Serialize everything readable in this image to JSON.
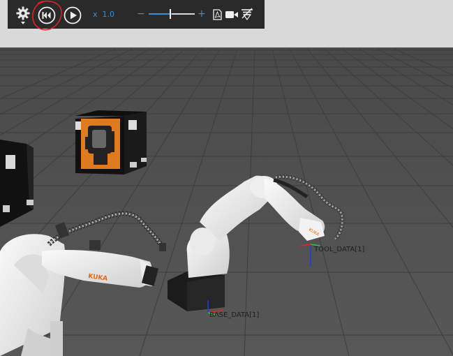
{
  "toolbar": {
    "speed_prefix": "x",
    "speed_value": "1.0",
    "slider_minus": "−",
    "slider_plus": "+",
    "settings_icon": "gear-icon",
    "rewind_icon": "rewind-to-start-icon",
    "play_icon": "play-icon",
    "pdf_icon": "pdf-export-icon",
    "camera_icon": "video-camera-icon",
    "signal_icon": "signal-icon",
    "accent_color": "#3b8fd9",
    "annotation_color": "#e0202a"
  },
  "viewport": {
    "tool_frame_label": "TOOL_DATA[1]",
    "base_frame_label": "BASE_DATA[1]",
    "robot_brand": "KUKA"
  }
}
